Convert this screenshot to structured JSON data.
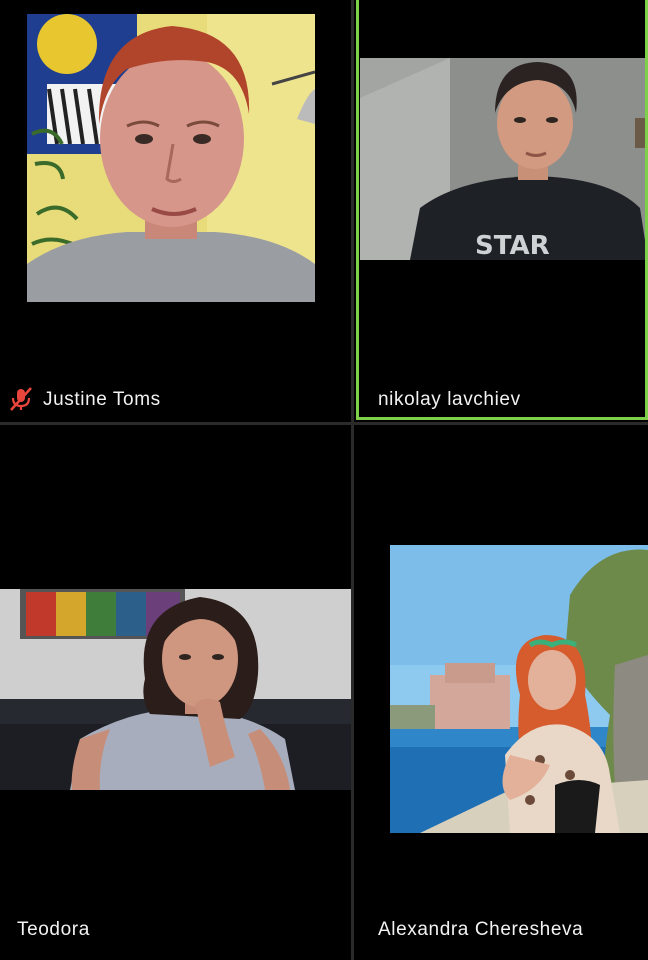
{
  "participants": [
    {
      "name": "Justine Toms",
      "muted": true,
      "active_speaker": false
    },
    {
      "name": "nikolay lavchiev",
      "muted": false,
      "active_speaker": true
    },
    {
      "name": "Teodora",
      "muted": false,
      "active_speaker": false
    },
    {
      "name": "Alexandra Cheresheva",
      "muted": false,
      "active_speaker": false
    }
  ],
  "colors": {
    "background": "#000000",
    "divider": "#2a2a2a",
    "active_speaker_border": "#7ed04b",
    "muted_icon": "#e8453c",
    "label_text": "#f2f2f2"
  },
  "icons": {
    "muted": "microphone-muted-icon"
  }
}
